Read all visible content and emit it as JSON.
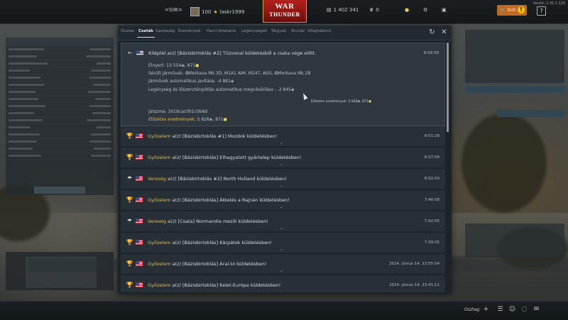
{
  "topbar": {
    "squad_tag": "=SIIK=",
    "level": "100",
    "username": "laskr1999",
    "logo_line1": "WAR",
    "logo_line2": "THUNDER",
    "silver_lions": "1 402 341",
    "eagles": "0",
    "shop_label": "Bolt",
    "version": "Verzió: 2.35.1.125",
    "help_label": "?"
  },
  "tabs": [
    {
      "label": "Összes",
      "active": false
    },
    {
      "label": "Csaták",
      "active": true
    },
    {
      "label": "Gazdaság",
      "active": false
    },
    {
      "label": "Események",
      "active": false
    },
    {
      "label": "Harci feladatok",
      "active": false
    },
    {
      "label": "Legénységek",
      "active": false
    },
    {
      "label": "Tárgyak",
      "active": false
    },
    {
      "label": "Áruház",
      "active": false
    },
    {
      "label": "Világháború",
      "active": false
    }
  ],
  "expanded_message": {
    "icon": "exit-icon",
    "title": "Kiléptél a(z) [Bázisbirtoklás #2] Tűzvonal küldetésből a csata vége előtt.",
    "time": "8:58:58",
    "earned": "Elnyert: 13 554",
    "earned_rp": ", 871",
    "damaged": "Sérült járművek: ✪Merkava Mk.3D, M1A1 AIM, M247, AGS, ✪Merkava Mk.2B",
    "auto_repair": "Járművek automatikus javítása: -4 881",
    "auto_supplies": "Legénység és lőszerutánpótlás automatikus megvásárlása : -2 845",
    "prelim_side": "Előzetes eredmények: 5 828",
    "prelim_side_rp": ", 871",
    "session": "Játszma: 3019cac001c0b8d",
    "prelim_label": "Előzetes eredmények:",
    "prelim_value": " 5 828",
    "prelim_rp": ", 871"
  },
  "messages": [
    {
      "result": "Győzelem",
      "text": " a(z) [Bázisbirtoklás #1] Mozdok küldetésben!",
      "time": "8:51:28",
      "icon": "trophy-icon"
    },
    {
      "result": "Győzelem",
      "text": " a(z) [Bázisbirtoklás] Elhagyatott gyártelep küldetésben!",
      "time": "8:37:58",
      "icon": "trophy-icon"
    },
    {
      "result": "Vereség",
      "text": " a(z) [Bázisbirtoklás #2] North Holland küldetésben!",
      "time": "8:02:50",
      "icon": "parachute-icon"
    },
    {
      "result": "Győzelem",
      "text": " a(z) [Bázisbirtoklás] Átkelés a Rajnán küldetésben!",
      "time": "7:48:08",
      "icon": "trophy-icon"
    },
    {
      "result": "Vereség",
      "text": " a(z) [Csata] Normandia mezői küldetésben!",
      "time": "7:42:05",
      "icon": "parachute-icon"
    },
    {
      "result": "Győzelem",
      "text": " a(z) [Bázisbirtoklás] Kárpátok küldetésben!",
      "time": "7:39:55",
      "icon": "trophy-icon"
    },
    {
      "result": "Győzelem",
      "text": " a(z) [Bázisbirtoklás] Aral-tó küldetésben!",
      "time": "2024. június 14. 23:55:54",
      "icon": "trophy-icon"
    },
    {
      "result": "Győzelem",
      "text": " a(z) [Bázisbirtoklás] Kelet-Európa küldetésben!",
      "time": "2024. június 14. 23:41:11",
      "icon": "trophy-icon"
    }
  ],
  "bottombar": {
    "squad_label": "Osztag:"
  },
  "colors": {
    "result_highlight": "#e2bb4a",
    "logo_red": "#b3201b",
    "shop_orange": "#c06a22"
  }
}
